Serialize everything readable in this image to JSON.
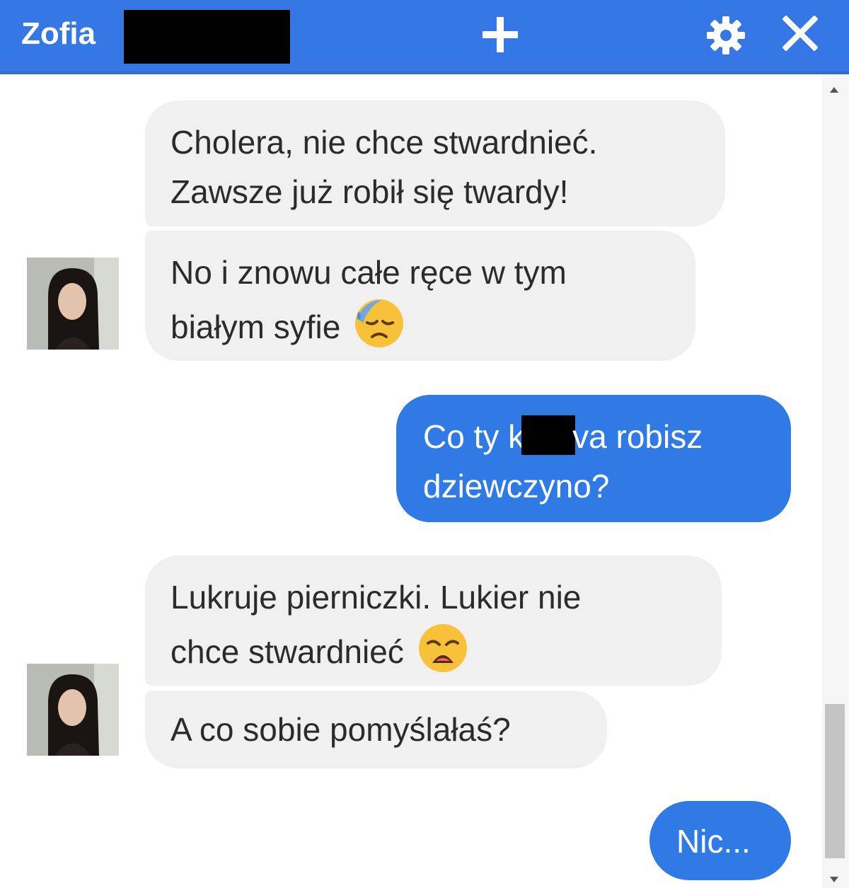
{
  "header": {
    "contact_name": "Zofia",
    "bar_color": "#3578e5",
    "icons": [
      "plus-icon",
      "gear-icon",
      "close-icon"
    ]
  },
  "messages": [
    {
      "sender": "contact",
      "lines": [
        "Cholera, nie chce stwardnieć.",
        "Zawsze już robił się twardy!"
      ]
    },
    {
      "sender": "contact",
      "lines": [
        "No i znowu całe ręce w tym",
        "białym syfie"
      ],
      "emoji": "sad-sweat-emoji"
    },
    {
      "sender": "me",
      "line1_before": "Co ty k",
      "line1_after": "va robisz",
      "line2": "dziewczyno?"
    },
    {
      "sender": "contact",
      "lines": [
        "Lukruje pierniczki. Lukier nie",
        "chce stwardnieć"
      ],
      "emoji": "weary-emoji"
    },
    {
      "sender": "contact",
      "lines": [
        "A co sobie pomyślałaś?"
      ]
    },
    {
      "sender": "me",
      "lines": [
        "Nic..."
      ]
    }
  ],
  "colors": {
    "incoming_bubble": "#f1f0f0",
    "outgoing_bubble": "#2f7ae5"
  }
}
